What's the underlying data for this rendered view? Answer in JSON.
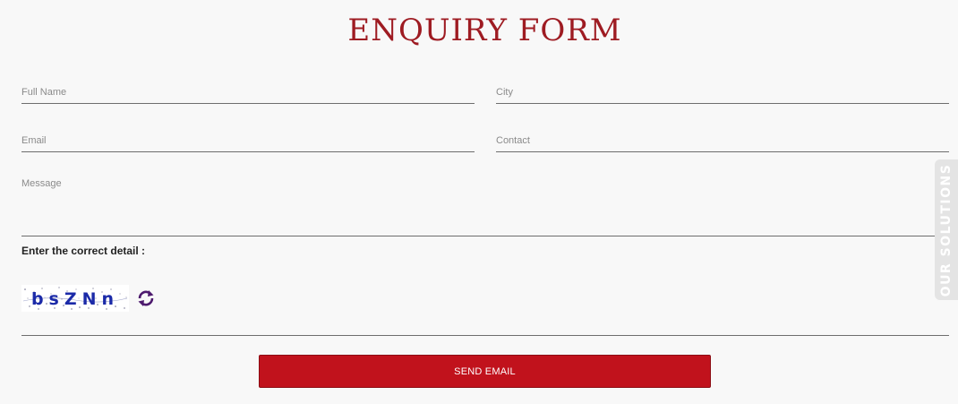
{
  "title": "ENQUIRY FORM",
  "fields": {
    "full_name": {
      "placeholder": "Full Name",
      "value": ""
    },
    "city": {
      "placeholder": "City",
      "value": ""
    },
    "email": {
      "placeholder": "Email",
      "value": ""
    },
    "contact": {
      "placeholder": "Contact",
      "value": ""
    },
    "message": {
      "placeholder": "Message",
      "value": ""
    }
  },
  "captcha": {
    "label": "Enter the correct detail :",
    "code": "bsZNn",
    "refresh_icon": "refresh-icon"
  },
  "submit": {
    "label": "SEND EMAIL"
  },
  "side_tab": {
    "label": "OUR SOLUTIONS"
  },
  "colors": {
    "title": "#9e1b22",
    "button": "#c1121c",
    "side_tab": "#e4e4e4",
    "captcha_text": "#1b2aa8",
    "refresh_icon": "#4d1a6e"
  }
}
